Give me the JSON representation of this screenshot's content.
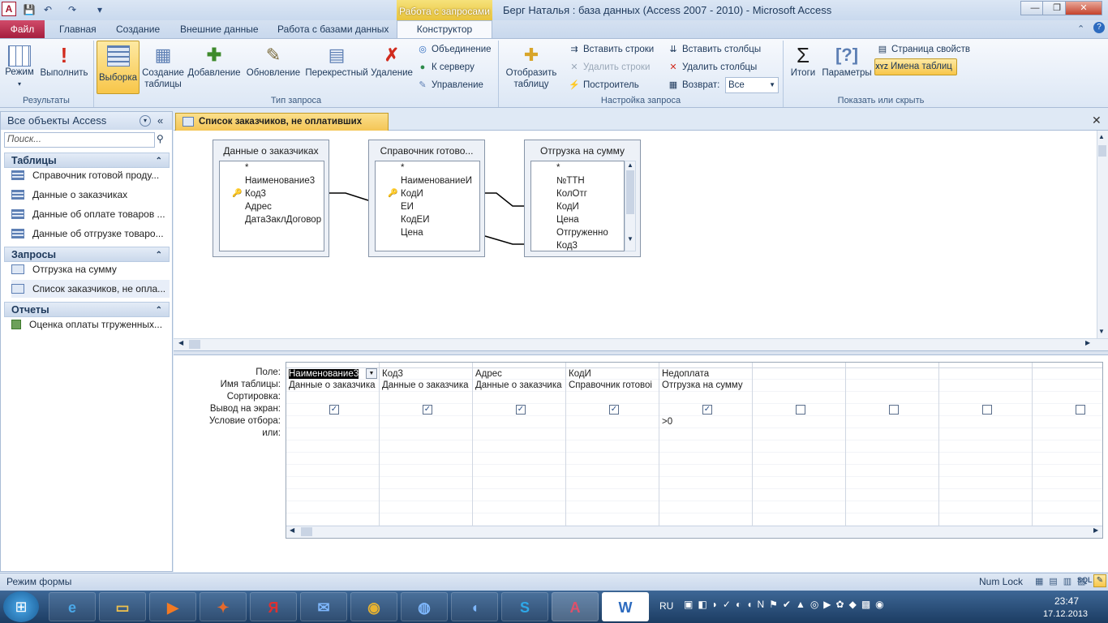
{
  "window": {
    "title": "Берг Наталья : база данных (Access 2007 - 2010)  -  Microsoft Access",
    "context_tab_header": "Работа с запросами",
    "min_label": "—",
    "restore_label": "❐",
    "close_label": "✕"
  },
  "tabs": {
    "file": "Файл",
    "home": "Главная",
    "create": "Создание",
    "external": "Внешние данные",
    "dbtools": "Работа с базами данных",
    "design": "Конструктор"
  },
  "ribbon": {
    "results": {
      "label": "Результаты",
      "view": "Режим",
      "run": "Выполнить"
    },
    "query_type": {
      "label": "Тип запроса",
      "select": "Выборка",
      "make_table_1": "Создание",
      "make_table_2": "таблицы",
      "append": "Добавление",
      "update": "Обновление",
      "crosstab": "Перекрестный",
      "delete": "Удаление",
      "union": "Объединение",
      "passthrough": "К серверу",
      "ddl": "Управление"
    },
    "setup": {
      "label": "Настройка запроса",
      "show_table_1": "Отобразить",
      "show_table_2": "таблицу",
      "insert_rows": "Вставить строки",
      "delete_rows": "Удалить строки",
      "builder": "Построитель",
      "insert_cols": "Вставить столбцы",
      "delete_cols": "Удалить столбцы",
      "return_label": "Возврат:",
      "return_value": "Все"
    },
    "show_hide": {
      "label": "Показать или скрыть",
      "totals": "Итоги",
      "parameters": "Параметры",
      "property_sheet": "Страница свойств",
      "table_names": "Имена таблиц"
    }
  },
  "nav": {
    "header": "Все объекты Access",
    "search_placeholder": "Поиск...",
    "sections": [
      {
        "title": "Таблицы",
        "items": [
          "Справочник готовой проду...",
          "Данные о заказчиках",
          "Данные об оплате товаров ...",
          "Данные об отгрузке товаро..."
        ]
      },
      {
        "title": "Запросы",
        "items": [
          "Отгрузка на сумму",
          "Список заказчиков, не опла..."
        ]
      },
      {
        "title": "Отчеты",
        "items": [
          "Оценка оплаты тгруженных..."
        ]
      }
    ]
  },
  "document": {
    "tab_title": "Список заказчиков, не оплативших товар"
  },
  "tables": [
    {
      "title": "Данные о заказчиках",
      "fields": [
        "*",
        "Наименование3",
        "Код3",
        "Адрес",
        "ДатаЗаклДоговор"
      ],
      "key_index": 2
    },
    {
      "title": "Справочник готово...",
      "fields": [
        "*",
        "НаименованиеИ",
        "КодИ",
        "ЕИ",
        "КодЕИ",
        "Цена"
      ],
      "key_index": 2
    },
    {
      "title": "Отгрузка на сумму",
      "fields": [
        "*",
        "№ТТН",
        "КолОтг",
        "КодИ",
        "Цена",
        "Отгруженно",
        "Код3"
      ],
      "key_index": -1
    }
  ],
  "grid": {
    "row_labels": [
      "Поле:",
      "Имя таблицы:",
      "Сортировка:",
      "Вывод на экран:",
      "Условие отбора:",
      "или:"
    ],
    "columns": [
      {
        "field": "Наименование3",
        "table": "Данные о заказчика",
        "sort": "",
        "show": true,
        "criteria": ""
      },
      {
        "field": "Код3",
        "table": "Данные о заказчика",
        "sort": "",
        "show": true,
        "criteria": ""
      },
      {
        "field": "Адрес",
        "table": "Данные о заказчика",
        "sort": "",
        "show": true,
        "criteria": ""
      },
      {
        "field": "КодИ",
        "table": "Справочник готовоі",
        "sort": "",
        "show": true,
        "criteria": ""
      },
      {
        "field": "Недоплата",
        "table": "Отгрузка на сумму",
        "sort": "",
        "show": true,
        "criteria": ">0"
      },
      {
        "field": "",
        "table": "",
        "sort": "",
        "show": false,
        "criteria": ""
      },
      {
        "field": "",
        "table": "",
        "sort": "",
        "show": false,
        "criteria": ""
      },
      {
        "field": "",
        "table": "",
        "sort": "",
        "show": false,
        "criteria": ""
      },
      {
        "field": "",
        "table": "",
        "sort": "",
        "show": false,
        "criteria": ""
      }
    ]
  },
  "status": {
    "mode": "Режим формы",
    "numlock": "Num Lock"
  },
  "taskbar": {
    "lang": "RU",
    "time": "23:47",
    "date": "17.12.2013"
  }
}
